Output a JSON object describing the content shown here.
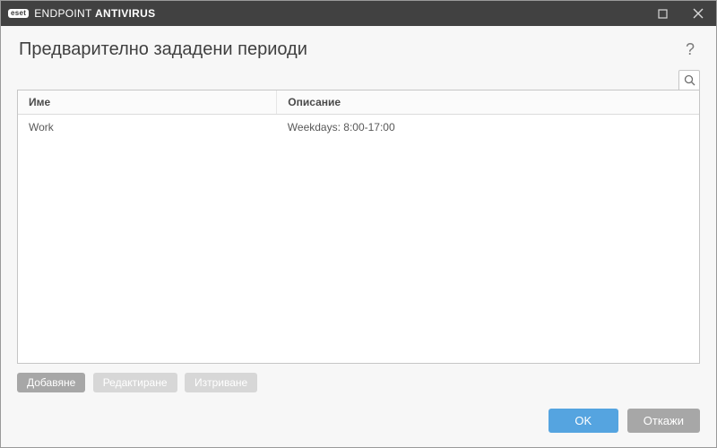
{
  "titlebar": {
    "brand_badge": "eset",
    "product_name_light": "ENDPOINT ",
    "product_name_bold": "ANTIVIRUS"
  },
  "header": {
    "title": "Предварително зададени периоди",
    "help_symbol": "?"
  },
  "table": {
    "columns": {
      "name": "Име",
      "description": "Описание"
    },
    "rows": [
      {
        "name": "Work",
        "description": "Weekdays: 8:00-17:00"
      }
    ]
  },
  "actions": {
    "add": "Добавяне",
    "edit": "Редактиране",
    "delete": "Изтриване"
  },
  "footer": {
    "ok": "OK",
    "cancel": "Откажи"
  }
}
